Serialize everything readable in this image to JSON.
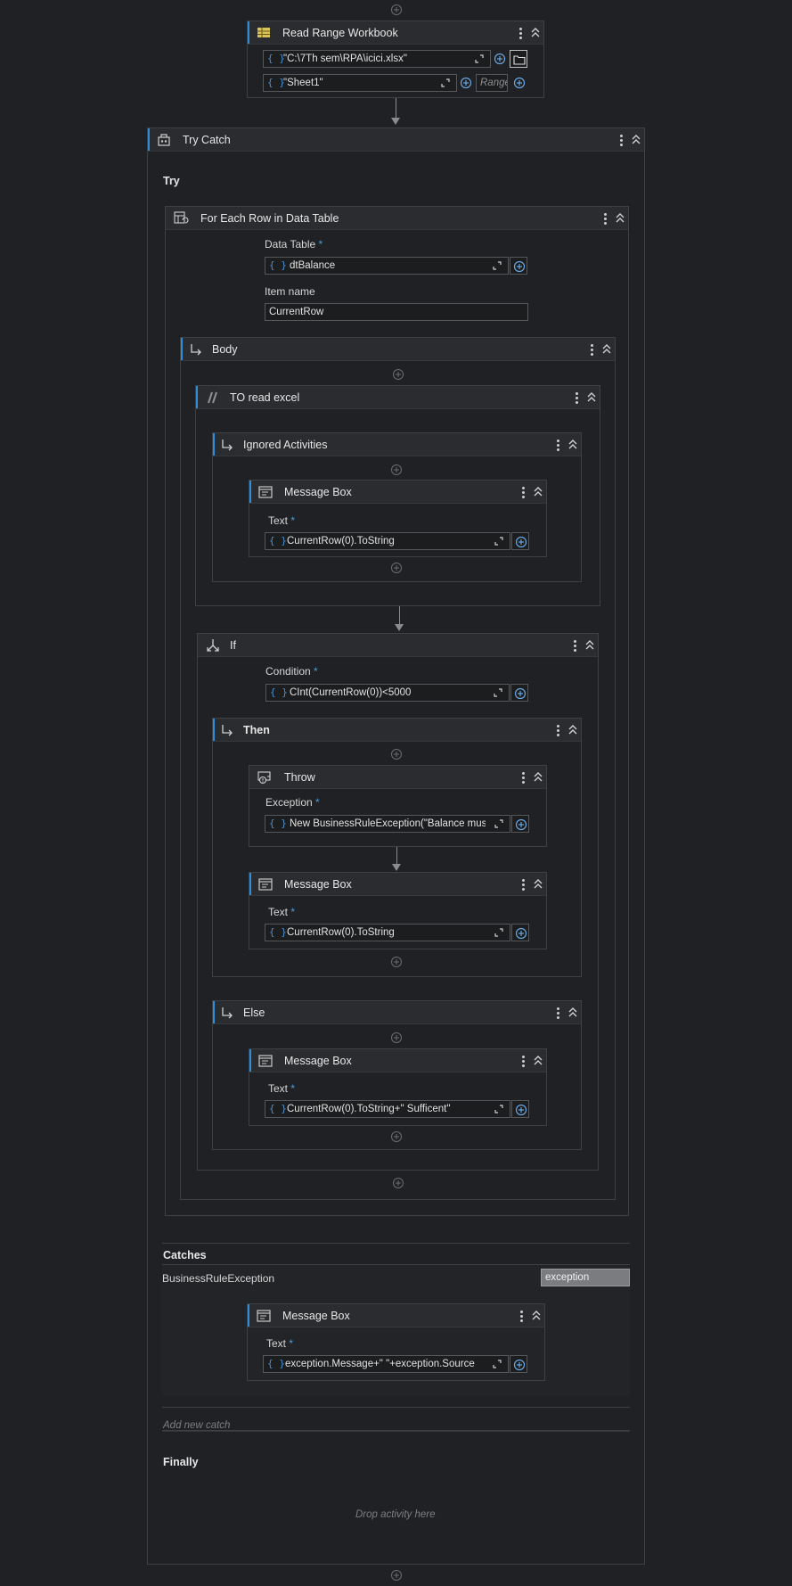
{
  "read_range": {
    "title": "Read Range Workbook",
    "path_value": "\"C:\\7Th sem\\RPA\\icici.xlsx\"",
    "sheet_value": "\"Sheet1\"",
    "range_placeholder": "Range"
  },
  "try_catch": {
    "title": "Try Catch",
    "try_label": "Try",
    "catches_label": "Catches",
    "exception_type": "BusinessRuleException",
    "exception_var": "exception",
    "add_new_catch": "Add new catch",
    "finally_label": "Finally",
    "drop_activity": "Drop activity here"
  },
  "for_each": {
    "title": "For Each Row in Data Table",
    "data_table_label": "Data Table",
    "data_table_value": "dtBalance",
    "item_name_label": "Item name",
    "item_name_value": "CurrentRow"
  },
  "body": {
    "title": "Body"
  },
  "comment_out": {
    "title": "TO read excel"
  },
  "ignored": {
    "title": "Ignored Activities"
  },
  "msg_ignored": {
    "title": "Message Box",
    "text_label": "Text",
    "text_value": "CurrentRow(0).ToString"
  },
  "if_activity": {
    "title": "If",
    "condition_label": "Condition",
    "condition_value": "CInt(CurrentRow(0))<5000",
    "then_label": "Then",
    "else_label": "Else"
  },
  "throw_activity": {
    "title": "Throw",
    "exception_label": "Exception",
    "exception_value": "New BusinessRuleException(\"Balance must"
  },
  "msg_then": {
    "title": "Message Box",
    "text_label": "Text",
    "text_value": "CurrentRow(0).ToString"
  },
  "msg_else": {
    "title": "Message Box",
    "text_label": "Text",
    "text_value": "CurrentRow(0).ToString+\" Sufficent\""
  },
  "msg_catch": {
    "title": "Message Box",
    "text_label": "Text",
    "text_value": "exception.Message+\" \"+exception.Source"
  },
  "required_mark": "*",
  "colors": {
    "background": "#202124",
    "accent": "#2f8ed8",
    "header": "#2b2c2f",
    "border": "#3f4042"
  }
}
